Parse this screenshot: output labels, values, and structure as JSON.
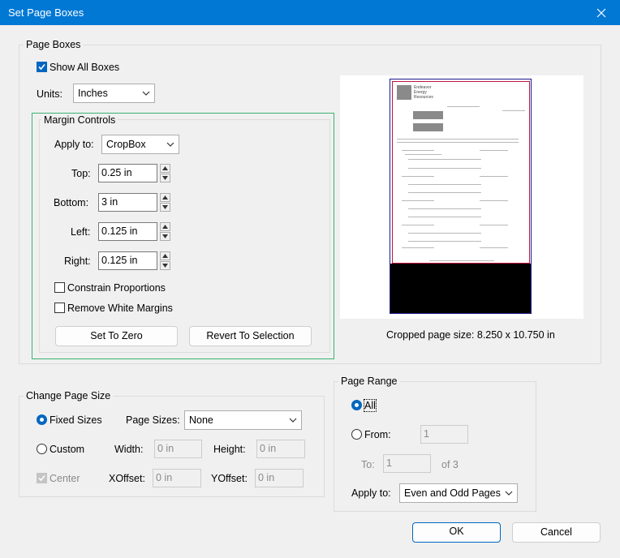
{
  "window": {
    "title": "Set Page Boxes"
  },
  "page_boxes": {
    "group_label": "Page Boxes",
    "show_all_boxes_label": "Show All Boxes",
    "units_label": "Units:",
    "units_value": "Inches",
    "preview_caption": "Cropped page size: 8.250 x 10.750 in",
    "preview_doc_lines": [
      "Endeavor",
      "Energy",
      "Resources"
    ]
  },
  "margin_controls": {
    "group_label": "Margin Controls",
    "apply_to_label": "Apply to:",
    "apply_to_value": "CropBox",
    "top_label": "Top:",
    "top_value": "0.25 in",
    "bottom_label": "Bottom:",
    "bottom_value": "3 in",
    "left_label": "Left:",
    "left_value": "0.125 in",
    "right_label": "Right:",
    "right_value": "0.125 in",
    "constrain_label": "Constrain Proportions",
    "remove_white_label": "Remove White Margins",
    "set_to_zero_label": "Set To Zero",
    "revert_label": "Revert To Selection"
  },
  "change_page_size": {
    "group_label": "Change Page Size",
    "fixed_sizes_label": "Fixed Sizes",
    "page_sizes_label": "Page Sizes:",
    "page_sizes_value": "None",
    "custom_label": "Custom",
    "width_label": "Width:",
    "width_value": "0 in",
    "height_label": "Height:",
    "height_value": "0 in",
    "center_label": "Center",
    "xoffset_label": "XOffset:",
    "xoffset_value": "0 in",
    "yoffset_label": "YOffset:",
    "yoffset_value": "0 in"
  },
  "page_range": {
    "group_label": "Page Range",
    "all_label": "All",
    "from_label": "From:",
    "from_value": "1",
    "to_label": "To:",
    "to_value": "1",
    "of_label": "of 3",
    "apply_to_label": "Apply to:",
    "apply_to_value": "Even and Odd Pages"
  },
  "footer": {
    "ok_label": "OK",
    "cancel_label": "Cancel"
  },
  "colors": {
    "titlebar": "#0078d4",
    "accent": "#0067c0",
    "margin_group_border": "#3cb371",
    "crop_box": "#c0143c",
    "media_box": "#1a1a8c"
  }
}
